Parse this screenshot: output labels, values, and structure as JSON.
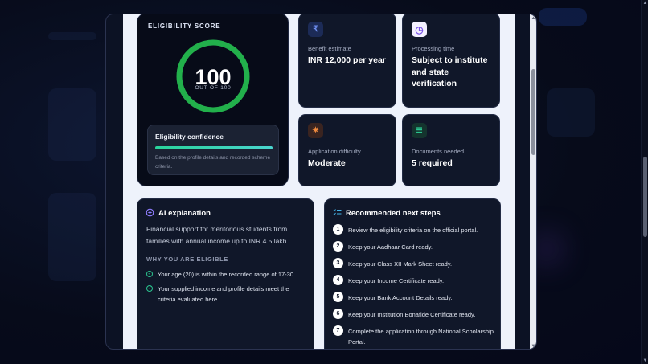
{
  "score": {
    "title": "ELIGIBILITY SCORE",
    "value": "100",
    "sub": "OUT OF 100",
    "fraction": 1.0,
    "ring_color": "#22b04b"
  },
  "confidence": {
    "title": "Eligibility confidence",
    "level": 1.0,
    "note": "Based on the profile details and recorded scheme criteria."
  },
  "cards": {
    "benefit": {
      "icon": "rupee-icon",
      "glyph": "₹",
      "label": "Benefit estimate",
      "value": "INR 12,000 per year"
    },
    "processing": {
      "icon": "clock-icon",
      "glyph": "◷",
      "label": "Processing time",
      "value": "Subject to institute and state verification"
    },
    "difficulty": {
      "icon": "difficulty-icon",
      "glyph": "✷",
      "label": "Application difficulty",
      "value": "Moderate"
    },
    "documents": {
      "icon": "checklist-icon",
      "glyph": "☰",
      "label": "Documents needed",
      "value": "5 required"
    }
  },
  "ai": {
    "title": "AI explanation",
    "description": "Financial support for meritorious students from families with annual income up to INR 4.5 lakh.",
    "subhead": "WHY YOU ARE ELIGIBLE",
    "reasons": [
      "Your age (20) is within the recorded range of 17-30.",
      "Your supplied income and profile details meet the criteria evaluated here."
    ]
  },
  "steps": {
    "title": "Recommended next steps",
    "items": [
      {
        "num": "1",
        "text": "Review the eligibility criteria on the official portal."
      },
      {
        "num": "2",
        "text": "Keep your Aadhaar Card ready."
      },
      {
        "num": "3",
        "text": "Keep your Class XII Mark Sheet ready."
      },
      {
        "num": "4",
        "text": "Keep your Income Certificate ready."
      },
      {
        "num": "5",
        "text": "Keep your Bank Account Details ready."
      },
      {
        "num": "6",
        "text": "Keep your Institution Bonafide Certificate ready."
      },
      {
        "num": "7",
        "text": "Complete the application through National Scholarship Portal."
      }
    ]
  },
  "colors": {
    "accent_green": "#22b04b",
    "teal": "#29d39b",
    "purple": "#8f7dff",
    "card_bg": "#101729"
  }
}
